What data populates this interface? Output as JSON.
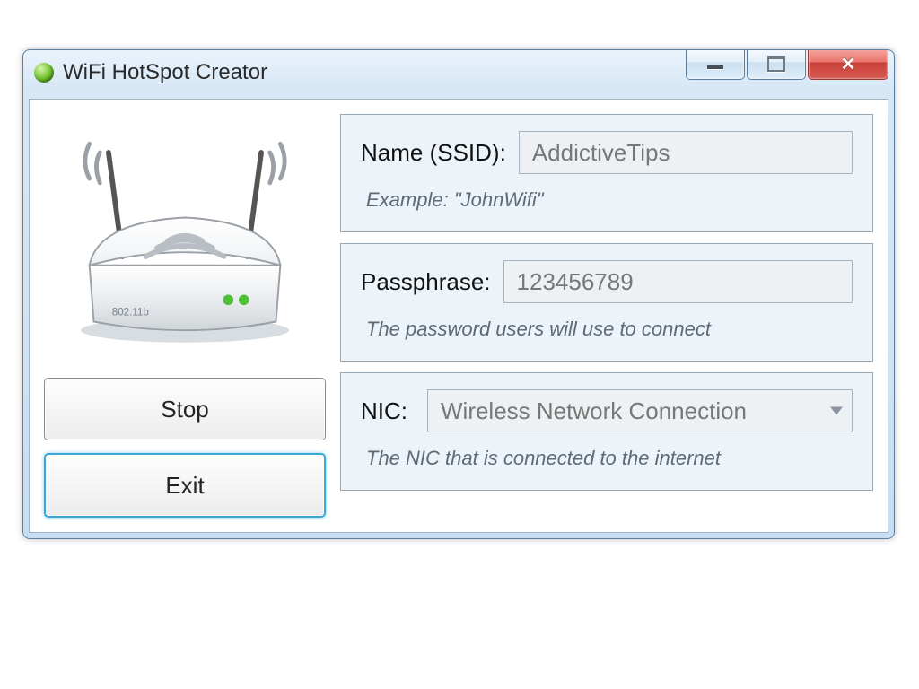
{
  "window": {
    "title": "WiFi HotSpot Creator"
  },
  "buttons": {
    "stop": "Stop",
    "exit": "Exit"
  },
  "ssid": {
    "label": "Name (SSID):",
    "value": "AddictiveTips",
    "hint": "Example: \"JohnWifi\""
  },
  "passphrase": {
    "label": "Passphrase:",
    "value": "123456789",
    "hint": "The password users will use to connect"
  },
  "nic": {
    "label": "NIC:",
    "value": "Wireless Network Connection",
    "hint": "The NIC that is connected to the internet"
  },
  "router_label": "802.11b"
}
